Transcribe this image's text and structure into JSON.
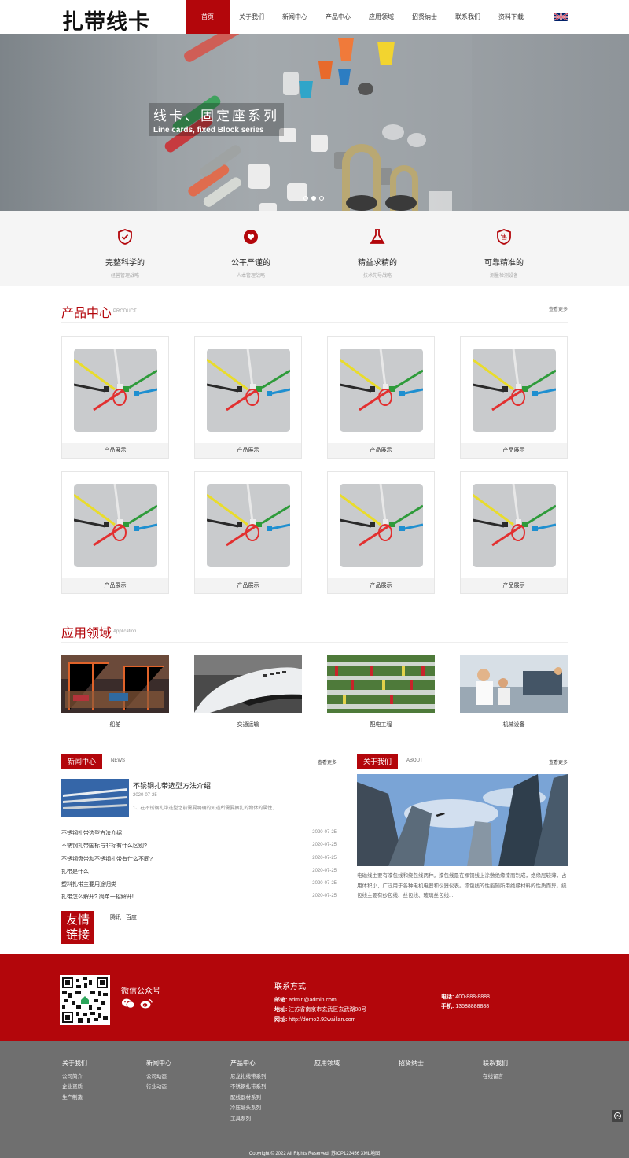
{
  "header": {
    "logo": "扎带线卡",
    "nav": [
      {
        "label": "首页",
        "active": true
      },
      {
        "label": "关于我们"
      },
      {
        "label": "新闻中心"
      },
      {
        "label": "产品中心"
      },
      {
        "label": "应用领域"
      },
      {
        "label": "招贤纳士"
      },
      {
        "label": "联系我们"
      },
      {
        "label": "资料下载"
      }
    ],
    "flag_icon": "uk-flag-icon"
  },
  "banner": {
    "title_cn": "线卡、固定座系列",
    "title_en": "Line cards, fixed Block series",
    "slides": 3,
    "active_slide": 2
  },
  "features": [
    {
      "title": "完整科学的",
      "sub": "经营管理战略",
      "icon": "shield-check-icon"
    },
    {
      "title": "公平严谨的",
      "sub": "人本管理战略",
      "icon": "heart-hand-icon"
    },
    {
      "title": "精益求精的",
      "sub": "技术先导战略",
      "icon": "flask-icon"
    },
    {
      "title": "可靠精准的",
      "sub": "测量检测设备",
      "icon": "shield-sale-icon"
    }
  ],
  "products": {
    "title_cn": "产品中心",
    "title_en": "PRODUCT",
    "more": "查看更多",
    "items": [
      "产品展示",
      "产品展示",
      "产品展示",
      "产品展示",
      "产品展示",
      "产品展示",
      "产品展示",
      "产品展示"
    ]
  },
  "applications": {
    "title_cn": "应用领域",
    "title_en": "Application",
    "items": [
      "船舶",
      "交通运输",
      "配电工程",
      "机械设备"
    ]
  },
  "news": {
    "title": "新闻中心",
    "en": "NEWS",
    "more": "查看更多",
    "featured": {
      "title": "不锈钢扎带选型方法介绍",
      "date": "2020-07-25",
      "desc": "1、在不锈钢扎带选型之前需要明确的知道所需要捆扎的物体的属性,..."
    },
    "list": [
      {
        "title": "不锈钢扎带选型方法介绍",
        "date": "2020-07-25"
      },
      {
        "title": "不锈钢扎带国标与非标有什么区别?",
        "date": "2020-07-25"
      },
      {
        "title": "不锈钢盘带和不锈钢扎带有什么不同?",
        "date": "2020-07-25"
      },
      {
        "title": "扎带是什么",
        "date": "2020-07-25"
      },
      {
        "title": "塑料扎带主要用途归类",
        "date": "2020-07-25"
      },
      {
        "title": "扎带怎么解开? 简单一招解开!",
        "date": "2020-07-25"
      }
    ]
  },
  "about": {
    "title": "关于我们",
    "en": "ABOUT",
    "more": "查看更多",
    "text": "电磁线主要有漆包线和绕包线两种。漆包线是在裸铜线上涂敷绝缘漆而制成，绝缘层较薄，占用体积小，广泛用于各种电机电器和仪器仪表。漆包线的性能随所用绝缘材料的性质而异。绕包线主要有纱包线、丝包线、玻璃丝包线..."
  },
  "friend_links": {
    "label_line1": "友情",
    "label_line2": "链接",
    "items": [
      "腾讯",
      "百度"
    ]
  },
  "footer_red": {
    "wechat": "微信公众号",
    "contact_title": "联系方式",
    "email_label": "邮箱:",
    "email": "admin@admin.com",
    "addr_label": "地址:",
    "addr": "江苏省南京市玄武区玄武湖88号",
    "web_label": "网址:",
    "web": "http://demo2.92wailian.com",
    "tel_label": "电话:",
    "tel": "400-888-8888",
    "mobile_label": "手机:",
    "mobile": "13588888888"
  },
  "footer_gray": {
    "columns": [
      {
        "title": "关于我们",
        "items": [
          "公司简介",
          "企业资质",
          "生产制造"
        ]
      },
      {
        "title": "新闻中心",
        "items": [
          "公司动态",
          "行业动态"
        ]
      },
      {
        "title": "产品中心",
        "items": [
          "尼龙扎线带系列",
          "不锈钢扎带系列",
          "配线器材系列",
          "冷压端头系列",
          "工具系列"
        ]
      },
      {
        "title": "应用领域",
        "items": []
      },
      {
        "title": "招贤纳士",
        "items": []
      },
      {
        "title": "联系我们",
        "items": [
          "在线留言"
        ]
      }
    ],
    "copyright": "Copyright © 2022 All Rights Reserved. 苏ICP123456 XML地图"
  },
  "colors": {
    "brand": "#b3060b",
    "footer_gray": "#6f6f6f",
    "feature_bg": "#f5f5f5"
  }
}
